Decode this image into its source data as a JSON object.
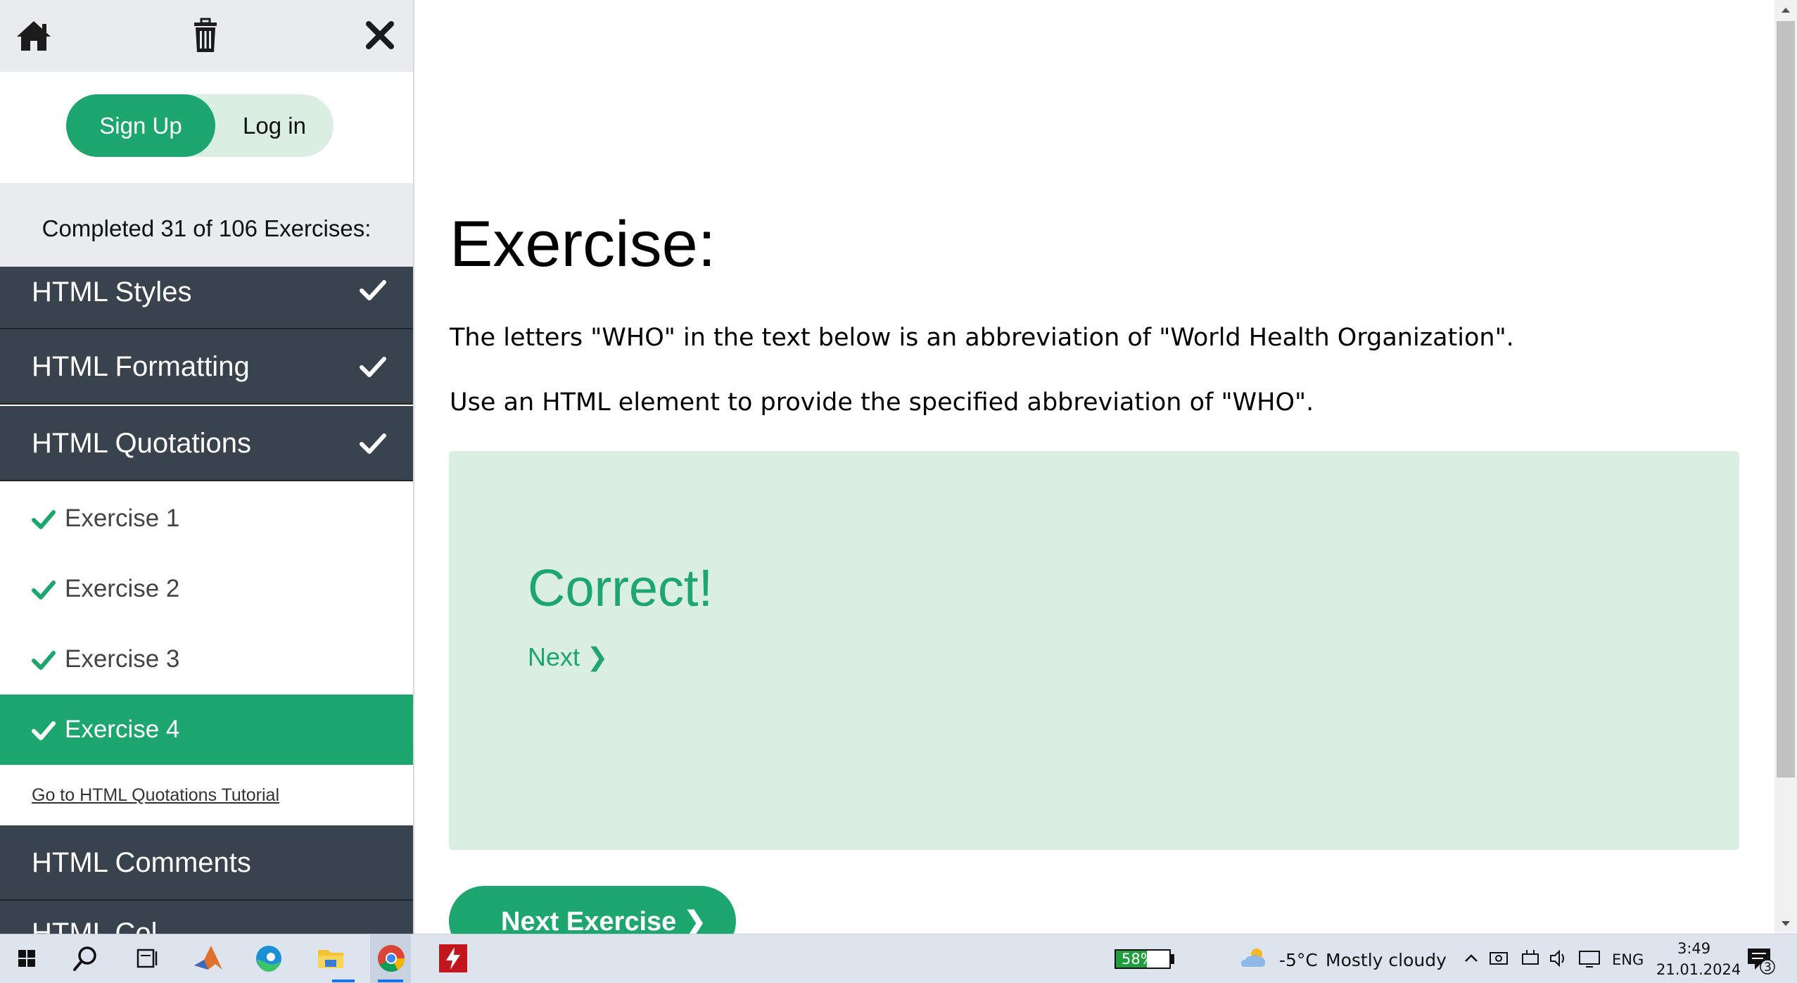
{
  "sidebar": {
    "top_icons": [
      "home-icon",
      "trash-icon",
      "close-icon"
    ],
    "auth": {
      "signup_label": "Sign Up",
      "login_label": "Log in"
    },
    "progress_text": "Completed 31 of 106 Exercises:",
    "sections": [
      {
        "label": "HTML Styles",
        "completed": true
      },
      {
        "label": "HTML Formatting",
        "completed": true
      },
      {
        "label": "HTML Quotations",
        "completed": true,
        "expanded": true
      },
      {
        "label": "HTML Comments",
        "completed": false
      },
      {
        "label": "HTML Col",
        "completed": false
      }
    ],
    "exercises": [
      {
        "label": "Exercise 1",
        "completed": true,
        "active": false
      },
      {
        "label": "Exercise 2",
        "completed": true,
        "active": false
      },
      {
        "label": "Exercise 3",
        "completed": true,
        "active": false
      },
      {
        "label": "Exercise 4",
        "completed": true,
        "active": true
      }
    ],
    "tutorial_link": "Go to HTML Quotations Tutorial"
  },
  "main": {
    "title": "Exercise:",
    "instructions": [
      "The letters \"WHO\" in the text below is an abbreviation of \"World Health Organization\".",
      "Use an HTML element to provide the specified abbreviation of \"WHO\"."
    ],
    "result": {
      "message": "Correct!",
      "next_label": "Next ❯"
    },
    "next_exercise_label": "Next Exercise ❯"
  },
  "taskbar": {
    "icons": [
      "windows-start-icon",
      "search-icon",
      "task-view-icon",
      "matlab-icon",
      "edge-icon",
      "file-explorer-icon",
      "chrome-icon",
      "app-red-icon"
    ],
    "battery_percent": "58%",
    "battery_level": 0.58,
    "weather_temp": "-5°C",
    "weather_desc": "Mostly cloudy",
    "language": "ENG",
    "time": "3:49",
    "date": "21.01.2024",
    "notification_count": "3"
  },
  "colors": {
    "accent": "#1ea66f",
    "sidebar_section_bg": "#38434d",
    "result_bg": "#daeee1",
    "taskbar_bg": "#dde4ee"
  }
}
